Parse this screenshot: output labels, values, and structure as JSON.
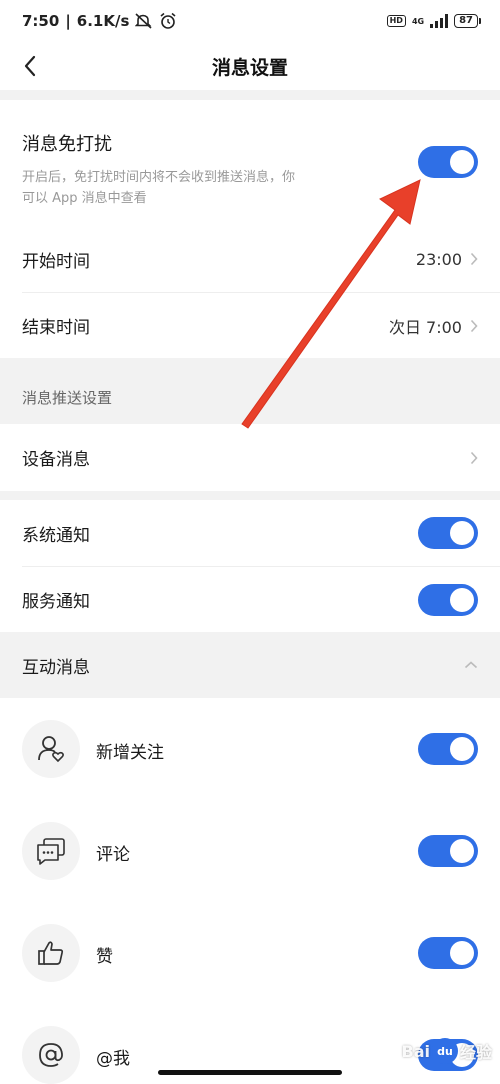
{
  "status_bar": {
    "time": "7:50",
    "net_speed": "6.1K/s",
    "hd": "HD",
    "net_type": "4G",
    "battery": "87"
  },
  "header": {
    "title": "消息设置"
  },
  "dnd": {
    "title": "消息免打扰",
    "desc_line1": "开启后，免打扰时间内将不会收到推送消息，你",
    "desc_line2": "可以 App 消息中查看",
    "enabled": true,
    "start_label": "开始时间",
    "start_value": "23:00",
    "end_label": "结束时间",
    "end_value": "次日 7:00"
  },
  "push_section": {
    "title": "消息推送设置",
    "device_label": "设备消息",
    "system_label": "系统通知",
    "system_enabled": true,
    "service_label": "服务通知",
    "service_enabled": true
  },
  "interaction": {
    "title": "互动消息",
    "items": [
      {
        "label": "新增关注",
        "icon": "user-heart-icon",
        "enabled": true
      },
      {
        "label": "评论",
        "icon": "comment-icon",
        "enabled": true
      },
      {
        "label": "赞",
        "icon": "thumbs-up-icon",
        "enabled": true
      },
      {
        "label": "@我",
        "icon": "at-icon",
        "enabled": true
      }
    ]
  },
  "watermark": {
    "brand1": "Bai",
    "brand_mark": "du",
    "brand2": "经验"
  },
  "colors": {
    "accent": "#2f6fe6",
    "annotation": "#e8402a"
  }
}
